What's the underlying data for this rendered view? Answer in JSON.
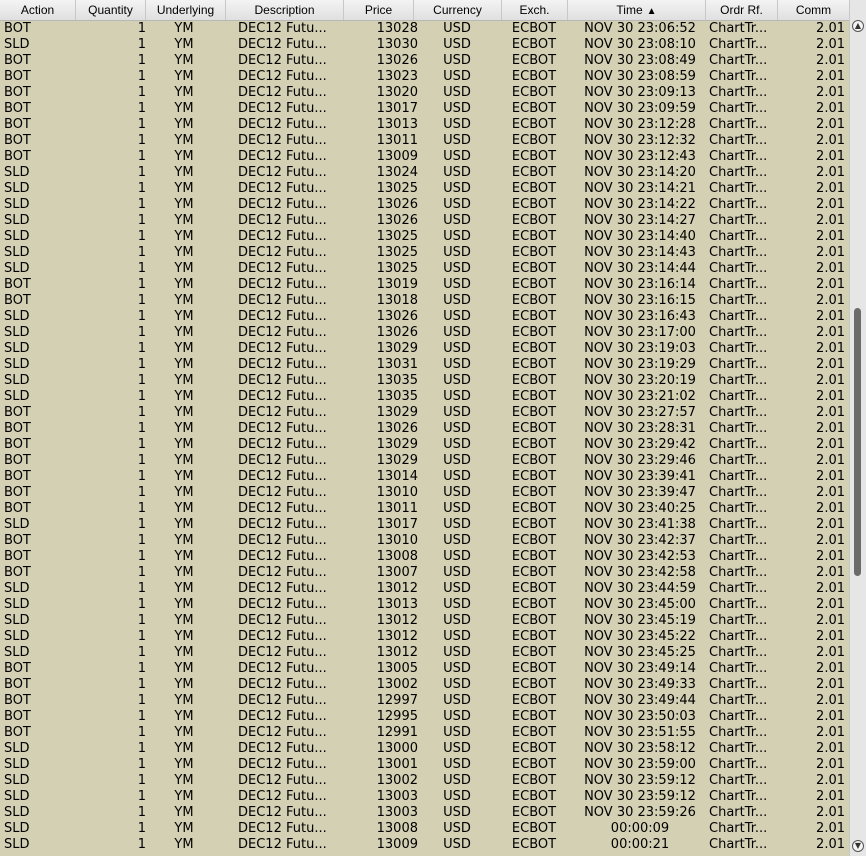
{
  "columns": [
    {
      "key": "action",
      "label": "Action"
    },
    {
      "key": "quantity",
      "label": "Quantity"
    },
    {
      "key": "underlying",
      "label": "Underlying"
    },
    {
      "key": "description",
      "label": "Description"
    },
    {
      "key": "price",
      "label": "Price"
    },
    {
      "key": "currency",
      "label": "Currency"
    },
    {
      "key": "exchange",
      "label": "Exch."
    },
    {
      "key": "time",
      "label": "Time",
      "sort": "ascending"
    },
    {
      "key": "order_ref",
      "label": "Ordr Rf."
    },
    {
      "key": "commission",
      "label": "Comm"
    }
  ],
  "icons": {
    "sort_arrow": "triangle-up-icon",
    "scroll_up": "chevron-up-icon",
    "scroll_down": "chevron-down-icon"
  },
  "colors": {
    "row_background": "#d4d0b4",
    "header_background": "#ececec",
    "scrollbar_thumb": "#6b6b6b"
  },
  "defaults": {
    "quantity": "1",
    "underlying": "YM",
    "description": "DEC12 Futu...",
    "currency": "USD",
    "exchange": "ECBOT",
    "order_ref": "ChartTr...",
    "commission": "2.01"
  },
  "rows": [
    {
      "action": "BOT",
      "price": "13028",
      "time": "NOV 30 23:06:52"
    },
    {
      "action": "SLD",
      "price": "13030",
      "time": "NOV 30 23:08:10"
    },
    {
      "action": "BOT",
      "price": "13026",
      "time": "NOV 30 23:08:49"
    },
    {
      "action": "BOT",
      "price": "13023",
      "time": "NOV 30 23:08:59"
    },
    {
      "action": "BOT",
      "price": "13020",
      "time": "NOV 30 23:09:13"
    },
    {
      "action": "BOT",
      "price": "13017",
      "time": "NOV 30 23:09:59"
    },
    {
      "action": "BOT",
      "price": "13013",
      "time": "NOV 30 23:12:28"
    },
    {
      "action": "BOT",
      "price": "13011",
      "time": "NOV 30 23:12:32"
    },
    {
      "action": "BOT",
      "price": "13009",
      "time": "NOV 30 23:12:43"
    },
    {
      "action": "SLD",
      "price": "13024",
      "time": "NOV 30 23:14:20"
    },
    {
      "action": "SLD",
      "price": "13025",
      "time": "NOV 30 23:14:21"
    },
    {
      "action": "SLD",
      "price": "13026",
      "time": "NOV 30 23:14:22"
    },
    {
      "action": "SLD",
      "price": "13026",
      "time": "NOV 30 23:14:27"
    },
    {
      "action": "SLD",
      "price": "13025",
      "time": "NOV 30 23:14:40"
    },
    {
      "action": "SLD",
      "price": "13025",
      "time": "NOV 30 23:14:43"
    },
    {
      "action": "SLD",
      "price": "13025",
      "time": "NOV 30 23:14:44"
    },
    {
      "action": "BOT",
      "price": "13019",
      "time": "NOV 30 23:16:14"
    },
    {
      "action": "BOT",
      "price": "13018",
      "time": "NOV 30 23:16:15"
    },
    {
      "action": "SLD",
      "price": "13026",
      "time": "NOV 30 23:16:43"
    },
    {
      "action": "SLD",
      "price": "13026",
      "time": "NOV 30 23:17:00"
    },
    {
      "action": "SLD",
      "price": "13029",
      "time": "NOV 30 23:19:03"
    },
    {
      "action": "SLD",
      "price": "13031",
      "time": "NOV 30 23:19:29"
    },
    {
      "action": "SLD",
      "price": "13035",
      "time": "NOV 30 23:20:19"
    },
    {
      "action": "SLD",
      "price": "13035",
      "time": "NOV 30 23:21:02"
    },
    {
      "action": "BOT",
      "price": "13029",
      "time": "NOV 30 23:27:57"
    },
    {
      "action": "BOT",
      "price": "13026",
      "time": "NOV 30 23:28:31"
    },
    {
      "action": "BOT",
      "price": "13029",
      "time": "NOV 30 23:29:42"
    },
    {
      "action": "BOT",
      "price": "13029",
      "time": "NOV 30 23:29:46"
    },
    {
      "action": "BOT",
      "price": "13014",
      "time": "NOV 30 23:39:41"
    },
    {
      "action": "BOT",
      "price": "13010",
      "time": "NOV 30 23:39:47"
    },
    {
      "action": "BOT",
      "price": "13011",
      "time": "NOV 30 23:40:25"
    },
    {
      "action": "SLD",
      "price": "13017",
      "time": "NOV 30 23:41:38"
    },
    {
      "action": "BOT",
      "price": "13010",
      "time": "NOV 30 23:42:37"
    },
    {
      "action": "BOT",
      "price": "13008",
      "time": "NOV 30 23:42:53"
    },
    {
      "action": "BOT",
      "price": "13007",
      "time": "NOV 30 23:42:58"
    },
    {
      "action": "SLD",
      "price": "13012",
      "time": "NOV 30 23:44:59"
    },
    {
      "action": "SLD",
      "price": "13013",
      "time": "NOV 30 23:45:00"
    },
    {
      "action": "SLD",
      "price": "13012",
      "time": "NOV 30 23:45:19"
    },
    {
      "action": "SLD",
      "price": "13012",
      "time": "NOV 30 23:45:22"
    },
    {
      "action": "SLD",
      "price": "13012",
      "time": "NOV 30 23:45:25"
    },
    {
      "action": "BOT",
      "price": "13005",
      "time": "NOV 30 23:49:14"
    },
    {
      "action": "BOT",
      "price": "13002",
      "time": "NOV 30 23:49:33"
    },
    {
      "action": "BOT",
      "price": "12997",
      "time": "NOV 30 23:49:44"
    },
    {
      "action": "BOT",
      "price": "12995",
      "time": "NOV 30 23:50:03"
    },
    {
      "action": "BOT",
      "price": "12991",
      "time": "NOV 30 23:51:55"
    },
    {
      "action": "SLD",
      "price": "13000",
      "time": "NOV 30 23:58:12"
    },
    {
      "action": "SLD",
      "price": "13001",
      "time": "NOV 30 23:59:00"
    },
    {
      "action": "SLD",
      "price": "13002",
      "time": "NOV 30 23:59:12"
    },
    {
      "action": "SLD",
      "price": "13003",
      "time": "NOV 30 23:59:12"
    },
    {
      "action": "SLD",
      "price": "13003",
      "time": "NOV 30 23:59:26"
    },
    {
      "action": "SLD",
      "price": "13008",
      "time": "00:00:09"
    },
    {
      "action": "SLD",
      "price": "13009",
      "time": "00:00:21"
    }
  ]
}
